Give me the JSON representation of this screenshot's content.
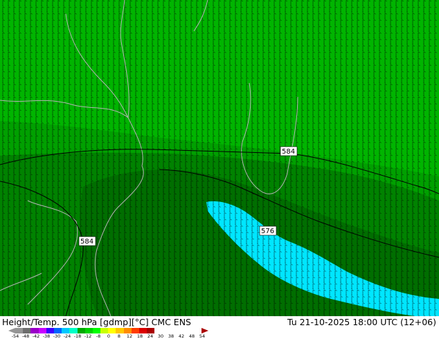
{
  "title": "Height/Temp. 500 hPa [gdmp][°C] CMC ENS",
  "valid_time": "Tu 21-10-2025 18:00 UTC (12+06)",
  "contour_labels": [
    "584",
    "584",
    "576"
  ],
  "colorbar": {
    "ticks": [
      "-54",
      "-48",
      "-42",
      "-38",
      "-30",
      "-24",
      "-18",
      "-12",
      "-8",
      "0",
      "8",
      "12",
      "18",
      "24",
      "30",
      "38",
      "42",
      "48",
      "54"
    ],
    "colors": [
      "#969696",
      "#6e6e6e",
      "#9a00c8",
      "#c800ff",
      "#3c00ff",
      "#0064ff",
      "#00c8ff",
      "#00ffc8",
      "#00aa00",
      "#00d200",
      "#00ff00",
      "#c8ff00",
      "#ffff00",
      "#ffc800",
      "#ff8c00",
      "#ff3c00",
      "#dc0000",
      "#aa0000"
    ]
  },
  "colors": {
    "field_light": "#00b400",
    "field_mid": "#00a000",
    "field_dark": "#008200",
    "field_darker": "#006e00",
    "cold_cyan": "#00e6ff",
    "coast": "#b4b4b4"
  }
}
